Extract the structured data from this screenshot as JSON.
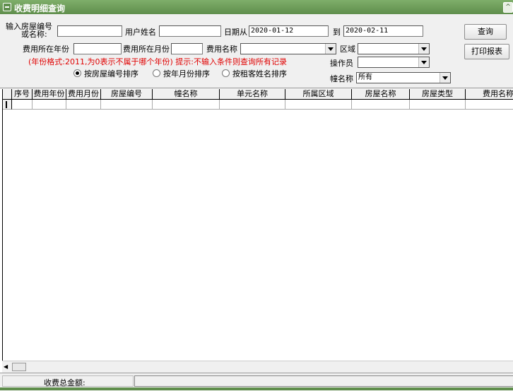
{
  "window": {
    "title": "收费明细查询"
  },
  "form": {
    "house_label_line1": "输入房屋编号",
    "house_label_line2": "或名称:",
    "house_value": "",
    "user_name_label": "用户姓名",
    "user_name_value": "",
    "date_from_label": "日期从",
    "date_from_value": "2020-01-12",
    "date_to_label": "到",
    "date_to_value": "2020-02-11",
    "fee_year_label": "费用所在年份",
    "fee_year_value": "",
    "fee_month_label": "费用所在月份",
    "fee_month_value": "",
    "fee_name_label": "费用名称",
    "fee_name_value": "",
    "region_label": "区域",
    "region_value": "",
    "operator_label": "操作员",
    "operator_value": "",
    "building_label": "幢名称",
    "building_value": "所有",
    "hint": "(年份格式:2011,为0表示不属于哪个年份) 提示:不输入条件则查询所有记录",
    "sort_options": [
      {
        "label": "按房屋编号排序",
        "selected": true
      },
      {
        "label": "按年月份排序",
        "selected": false
      },
      {
        "label": "按租客姓名排序",
        "selected": false
      }
    ]
  },
  "buttons": {
    "query": "查询",
    "print": "打印报表"
  },
  "table": {
    "columns": [
      "序号",
      "费用年份",
      "费用月份",
      "房屋编号",
      "幢名称",
      "单元名称",
      "所属区域",
      "房屋名称",
      "房屋类型",
      "费用名称"
    ]
  },
  "footer": {
    "total_label": "收费总金额:",
    "total_value": ""
  },
  "colors": {
    "titlebar": "#5f8e4c",
    "hint": "#e00000",
    "panel": "#f0f0f0"
  }
}
